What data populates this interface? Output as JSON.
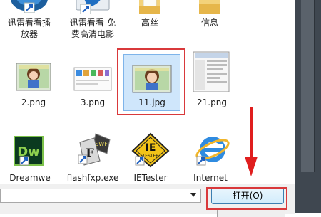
{
  "files": [
    {
      "label_line1": "迅雷看看播",
      "label_line2": "放器",
      "icon": "xunlei-player-icon"
    },
    {
      "label_line1": "迅雷看看-免",
      "label_line2": "费高清电影",
      "icon": "xunlei-movie-icon"
    },
    {
      "label_line1": "高丝",
      "label_line2": "",
      "icon": "folder-icon"
    },
    {
      "label_line1": "信息",
      "label_line2": "",
      "icon": "folder-icon"
    },
    {
      "label_line1": "2.png",
      "label_line2": "",
      "icon": "image-thumbnail-icon"
    },
    {
      "label_line1": "3.png",
      "label_line2": "",
      "icon": "image-thumbnail-icon"
    },
    {
      "label_line1": "11.jpg",
      "label_line2": "",
      "icon": "image-thumbnail-icon"
    },
    {
      "label_line1": "21.png",
      "label_line2": "",
      "icon": "image-thumbnail-icon"
    },
    {
      "label_line1": "Dreamwe",
      "label_line2": "",
      "icon": "dreamweaver-icon"
    },
    {
      "label_line1": "flashfxp.exe",
      "label_line2": "",
      "icon": "flashfxp-icon"
    },
    {
      "label_line1": "IETester",
      "label_line2": "",
      "icon": "ietester-icon"
    },
    {
      "label_line1": "Internet",
      "label_line2": "",
      "icon": "internet-explorer-icon"
    }
  ],
  "dw_text": "Dw",
  "ie_text": "IE",
  "ie_sub": "TESTER",
  "swf_text": "SWF",
  "open_button": "打开(O)",
  "colors": {
    "highlight": "#d9393b",
    "accent": "#3c7fb1"
  }
}
